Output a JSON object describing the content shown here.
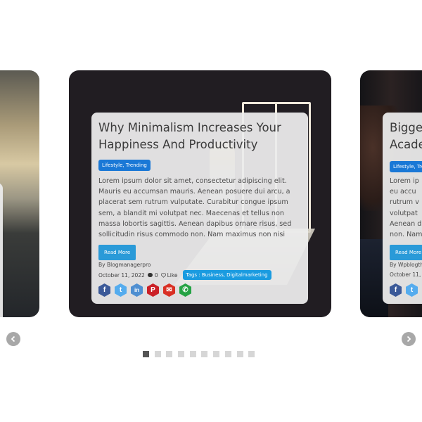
{
  "center_post": {
    "title": "Why Minimalism Increases Your Happiness And Productivity",
    "categories": "Lifestyle, Trending",
    "excerpt": "Lorem ipsum dolor sit amet, consectetur adipiscing elit. Mauris eu accumsan mauris. Aenean posuere dui arcu, a placerat sem rutrum vulputate. Curabitur congue ipsum sem, a blandit mi volutpat nec. Maecenas et tellus non massa lobortis sagittis. Aenean dapibus ornare risus, sed sollicitudin risus commodo non. Nam maximus non nisi",
    "read_more": "Read More",
    "author": "By Blogmanagerpro",
    "date": "October 11, 2022",
    "comments": "0",
    "like": "Like",
    "tags": "Tags : Business, Digitalmarketing",
    "share_icons": [
      {
        "name": "facebook-icon",
        "glyph": "f",
        "color": "#3b5998"
      },
      {
        "name": "twitter-icon",
        "glyph": "t",
        "color": "#55acee"
      },
      {
        "name": "linkedin-icon",
        "glyph": "in",
        "color": "#4f8fd1"
      },
      {
        "name": "pinterest-icon",
        "glyph": "P",
        "color": "#cb2027"
      },
      {
        "name": "email-icon",
        "glyph": "✉",
        "color": "#d93025"
      },
      {
        "name": "whatsapp-icon",
        "glyph": "✆",
        "color": "#25a244"
      }
    ]
  },
  "right_post": {
    "title_line1": "Bigges",
    "title_line2": "Acade",
    "categories": "Lifestyle, Tren",
    "excerpt_lines": [
      "Lorem ip",
      "eu accu",
      "rutrum v",
      "volutpat",
      "Aenean d",
      "non. Nam"
    ],
    "read_more": "Read More",
    "author": "By Wpblogthe",
    "date": "October 11,"
  },
  "left_post": {
    "excerpt_fragments": [
      "s",
      "o"
    ]
  },
  "carousel": {
    "prev_icon": "chevron-left-icon",
    "next_icon": "chevron-right-icon",
    "dot_count": 10,
    "active_dot": 1
  }
}
